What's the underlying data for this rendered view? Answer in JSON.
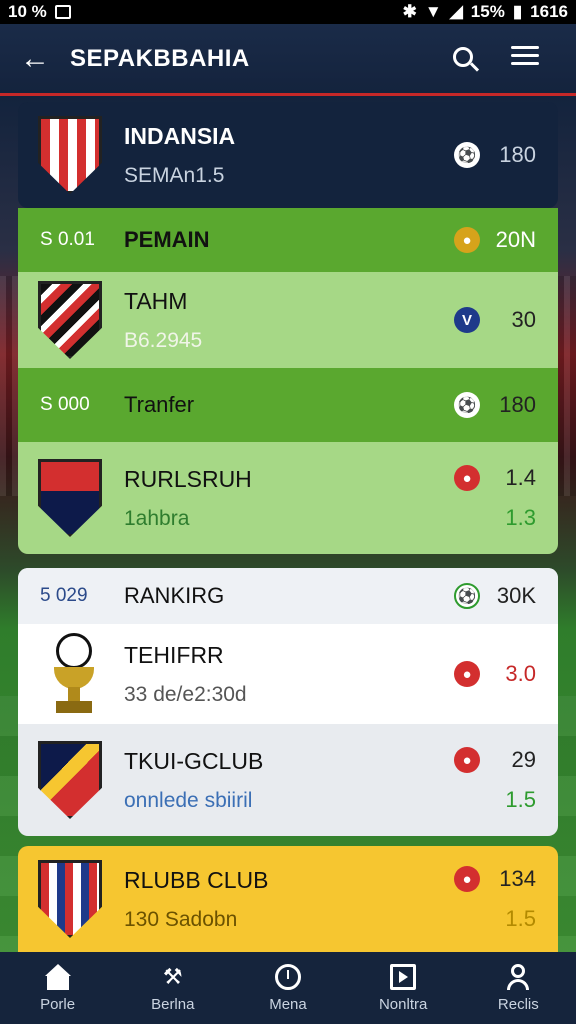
{
  "status_bar": {
    "left_text": "10 %",
    "battery": "15%",
    "time": "1616"
  },
  "app_bar": {
    "title": "SEPAKBBAHIA"
  },
  "cards": [
    {
      "title": "INDANSIA",
      "subtitle": "SEMAn1.5",
      "value": "180",
      "badge_icon": "soccer-ball-icon"
    },
    {
      "section_amount": "S 0.01",
      "section_name": "PEMAIN",
      "section_value": "20N",
      "title": "TAHM",
      "subtitle": "B6.2945",
      "value": "30",
      "badge_icon": "shield-badge-icon"
    },
    {
      "section_amount": "S 000",
      "section_name": "Tranfer",
      "section_value": "180",
      "title": "RURLSRUH",
      "subtitle": "1ahbra",
      "value": "1.4",
      "value2": "1.3",
      "badge_icon": "red-badge-icon"
    },
    {
      "section_amount": "5 029",
      "section_name": "RANKIRG",
      "section_value": "30K",
      "title": "TEHIFRR",
      "subtitle": "33 de/e2:30d",
      "value": "3.0",
      "badge_icon": "red-badge-icon"
    },
    {
      "title": "TKUI-GCLUB",
      "subtitle": "onnlede sbiiril",
      "value": "29",
      "value2": "1.5",
      "badge_icon": "red-badge-icon"
    },
    {
      "title": "RLUBB CLUB",
      "subtitle": "130 Sadobn",
      "value": "134",
      "value2": "1.5",
      "badge_icon": "red-badge-icon"
    }
  ],
  "bottom_nav": [
    {
      "label": "Porle",
      "icon": "home-icon"
    },
    {
      "label": "Berlna",
      "icon": "hammer-icon"
    },
    {
      "label": "Mena",
      "icon": "clock-icon"
    },
    {
      "label": "Nonltra",
      "icon": "play-box-icon"
    },
    {
      "label": "Reclis",
      "icon": "user-icon"
    }
  ],
  "colors": {
    "appbar": "#1a2b48",
    "accent_red": "#c62828",
    "green_section": "#5aa82f",
    "green_light": "#a6d886",
    "yellow_card": "#f6c630",
    "value_green": "#2e9b2e"
  }
}
